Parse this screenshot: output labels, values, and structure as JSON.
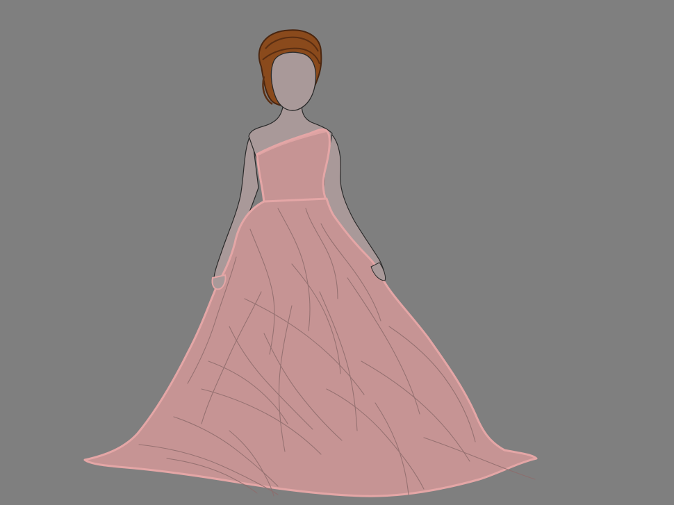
{
  "image": {
    "subject": "figure-in-pink-ball-gown",
    "colors": {
      "background": "#7f7f7f",
      "skin": "#a99999",
      "skin_outline": "#2a2a2a",
      "dress": "#c69494",
      "dress_highlight": "#e4a6a6",
      "dress_fold": "#8e6c6c",
      "hair": "#8a4a1c",
      "hair_dark": "#4a2610"
    }
  }
}
